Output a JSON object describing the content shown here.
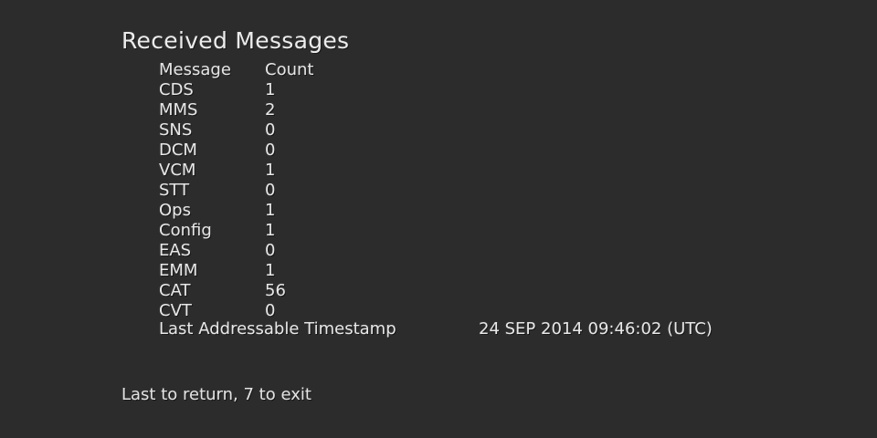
{
  "screen": {
    "title": "Received Messages",
    "columns": {
      "name": "Message",
      "count": "Count"
    },
    "messages": [
      {
        "name": "CDS",
        "count": "1"
      },
      {
        "name": "MMS",
        "count": "2"
      },
      {
        "name": "SNS",
        "count": "0"
      },
      {
        "name": "DCM",
        "count": "0"
      },
      {
        "name": "VCM",
        "count": "1"
      },
      {
        "name": "STT",
        "count": "0"
      },
      {
        "name": "Ops",
        "count": "1"
      },
      {
        "name": "Config",
        "count": "1"
      },
      {
        "name": "EAS",
        "count": "0"
      },
      {
        "name": "EMM",
        "count": "1"
      },
      {
        "name": "CAT",
        "count": "56"
      },
      {
        "name": "CVT",
        "count": "0"
      }
    ],
    "timestamp": {
      "label": "Last Addressable Timestamp",
      "value": "24 SEP 2014 09:46:02 (UTC)"
    },
    "footer": "Last to return, 7 to exit"
  },
  "colors": {
    "background": "#2c2c2c",
    "text": "#e8e8e8"
  }
}
